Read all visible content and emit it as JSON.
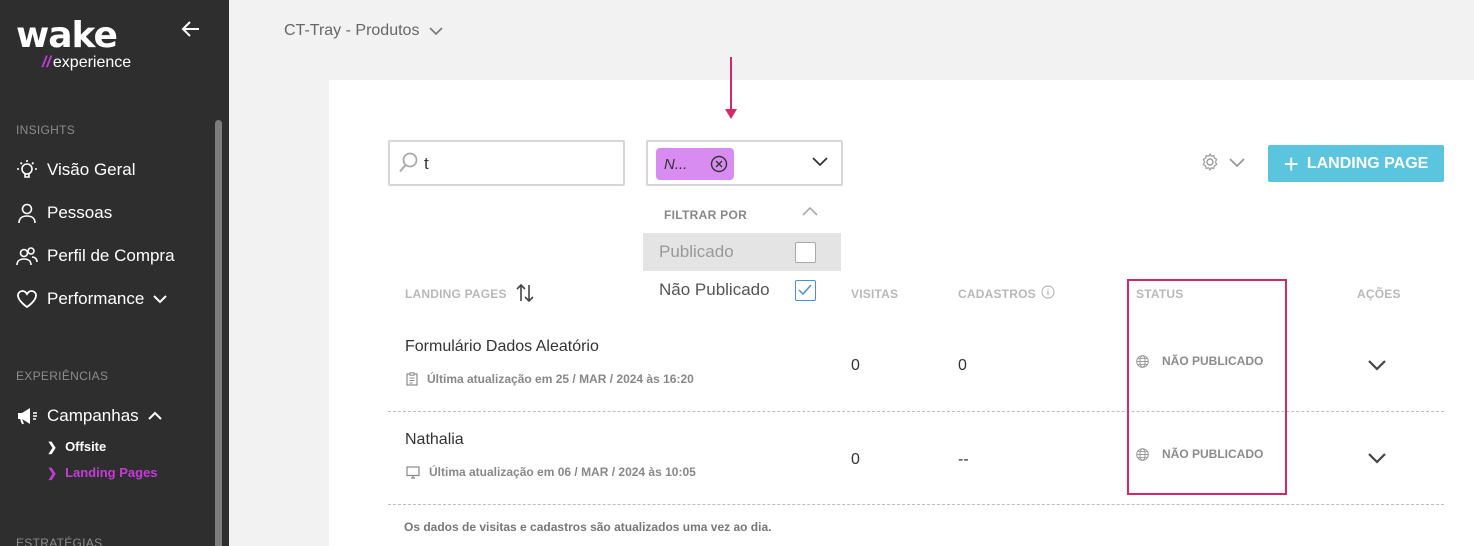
{
  "sidebar": {
    "logo_main": "wake",
    "logo_slash": "//",
    "logo_sub": "experience",
    "sections": {
      "insights": "INSIGHTS",
      "experiencias": "EXPERIÊNCIAS",
      "estrategias": "ESTRATÉGIAS"
    },
    "items": {
      "visao_geral": "Visão Geral",
      "pessoas": "Pessoas",
      "perfil_compra": "Perfil de Compra",
      "performance": "Performance",
      "campanhas": "Campanhas"
    },
    "subitems": {
      "offsite": "Offsite",
      "landing_pages": "Landing Pages"
    },
    "active_color": "#c63bd8"
  },
  "breadcrumb": {
    "label": "CT-Tray - Produtos"
  },
  "toolbar": {
    "search_value": "t",
    "filter_chip": "N...",
    "add_button": "LANDING PAGE",
    "accent_color": "#5bc5e0"
  },
  "filter_dropdown": {
    "heading": "FILTRAR POR",
    "options": [
      {
        "label": "Publicado",
        "checked": false
      },
      {
        "label": "Não Publicado",
        "checked": true
      }
    ]
  },
  "table": {
    "headers": {
      "landing_pages": "LANDING PAGES",
      "visitas": "VISITAS",
      "cadastros": "CADASTROS",
      "status": "STATUS",
      "acoes": "AÇÕES"
    },
    "rows": [
      {
        "title": "Formulário Dados Aleatório",
        "meta": "Última atualização em 25 / MAR / 2024 às 16:20",
        "visitas": "0",
        "cadastros": "0",
        "status": "NÃO PUBLICADO"
      },
      {
        "title": "Nathalia",
        "meta": "Última atualização em 06 / MAR / 2024 às 10:05",
        "visitas": "0",
        "cadastros": "--",
        "status": "NÃO PUBLICADO"
      }
    ],
    "footnote": "Os dados de visitas e cadastros são atualizados uma vez ao dia."
  },
  "annotation_color": "#d6276d"
}
